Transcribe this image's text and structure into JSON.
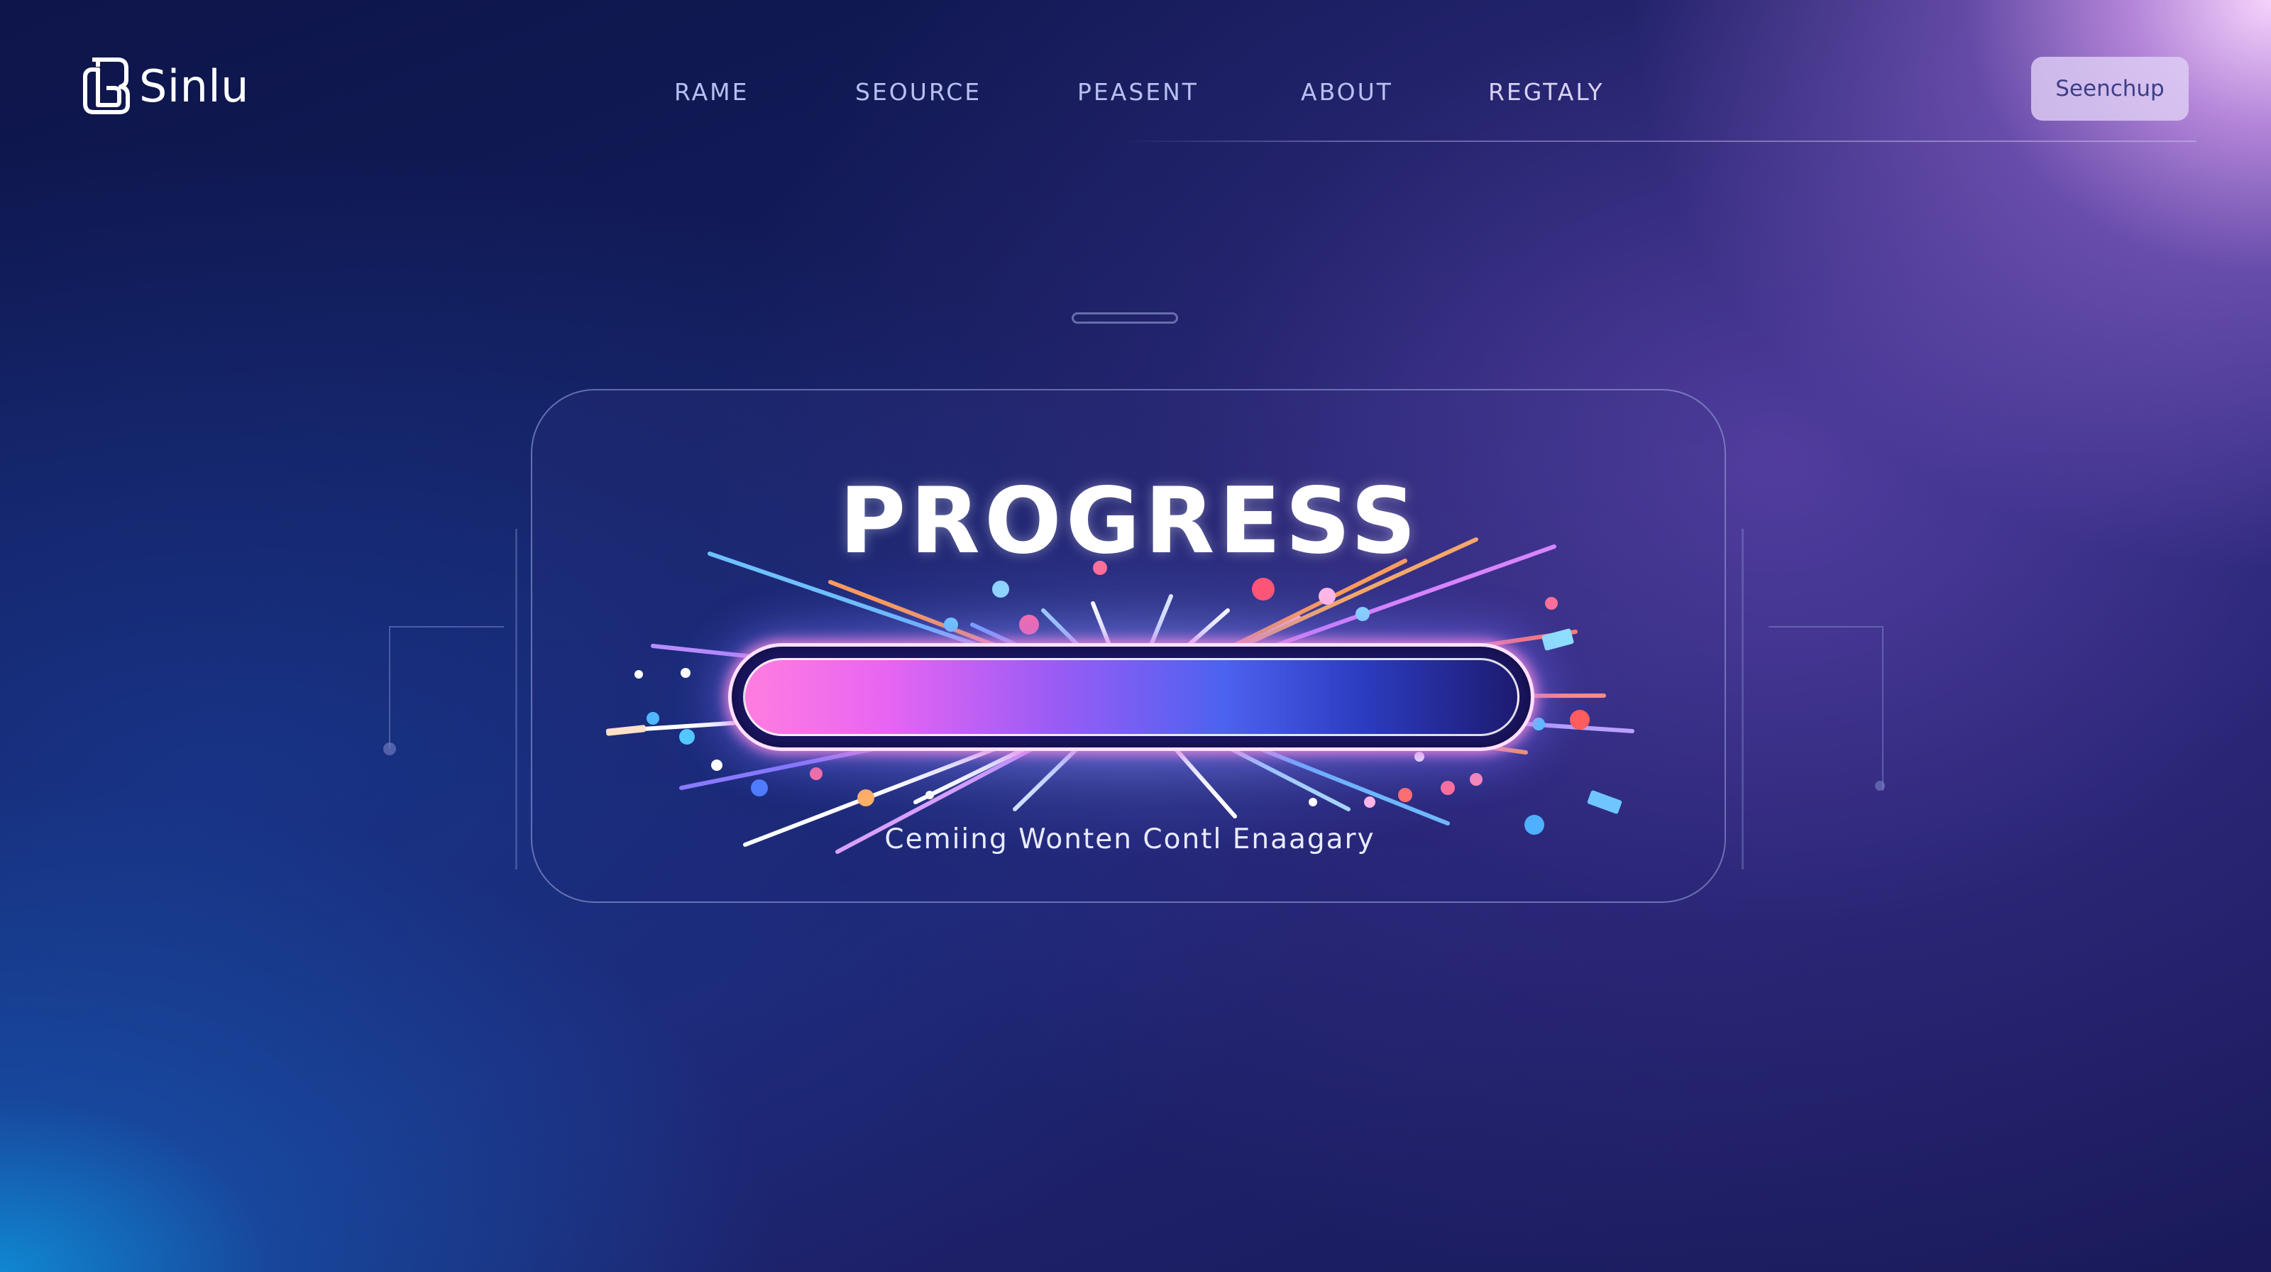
{
  "header": {
    "logo_text": "Sinlu",
    "logo_icon": "logo-mark-icon",
    "nav": [
      "RAME",
      "SEOURCE",
      "PEASENT",
      "ABOUT",
      "REGTALY"
    ],
    "button_label": "Seenchup"
  },
  "progress": {
    "title": "PROGRESS",
    "caption": "Cemiing Wonten Contl Enaagary",
    "value_fraction": 1.0
  },
  "colors": {
    "bar_start": "#ff7de0",
    "bar_mid": "#9a5cf5",
    "bar_end": "#1d1a70",
    "accent_glow": "#ff8cdc",
    "background_dark": "#0d154a",
    "background_light": "#d8b6f5"
  }
}
